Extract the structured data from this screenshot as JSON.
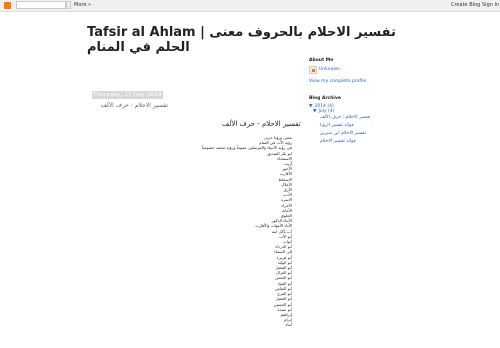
{
  "navbar": {
    "more": "More »",
    "create_blog": "Create Blog",
    "sign_in": "Sign In"
  },
  "blog": {
    "title": "Tafsir al Ahlam | تفسير الاحلام بالحروف معنى الحلم في المنام"
  },
  "post": {
    "date_header": "Thursday, 17 July 2014",
    "breadcrumb": "تفسير الاحلام : حرف الألف",
    "title": "تفسير الاحلام - حرف الألف",
    "items": [
      "معنى ورؤيا حرف",
      "رؤية الأب في المنام",
      "في رؤية الأنبياء والمرسلين عموماً ورؤية محمد خصوصاً",
      "ابو بكر الصديق",
      "الاستنجاء",
      "آزيت",
      "الأجور",
      "الأقارب",
      "الاسقاط",
      "الأغلال",
      "الأرق",
      "الأدب",
      "الاسرة",
      "الأمراء",
      "الأمانة",
      "الخلوي",
      "الأبناء الذكور",
      "الآباء الأمهات والأقارب",
      "أب يأكل ابنه",
      "أبو الأب",
      "أبواب",
      "أبو الدرداء",
      "إلى السماء",
      "أبو هريرة",
      "أبو الوليد",
      "أبو الفضل",
      "أبو الغزال",
      "أبو الحسن",
      "أبو الفتح",
      "أبو العباس",
      "أبو الفرج",
      "أبو الفضل",
      "أبو الحسين",
      "أبو عبيدة",
      "إبراهيم",
      "إبرام",
      "أبناء"
    ]
  },
  "sidebar": {
    "about_title": "About Me",
    "profile_name": "Unknown",
    "view_profile": "View my complete profile",
    "archive_title": "Blog Archive",
    "year": "2014 (4)",
    "month": "July (4)",
    "posts": [
      "تفسير الاحلام : حرف الألف",
      "فوائد تفسير الرؤيا",
      "تفسير الاحلام ابن سيرين",
      "فوائد تفسير الاحلام"
    ]
  },
  "colors": {
    "link": "#2966b8",
    "logo": "#f57d00"
  }
}
